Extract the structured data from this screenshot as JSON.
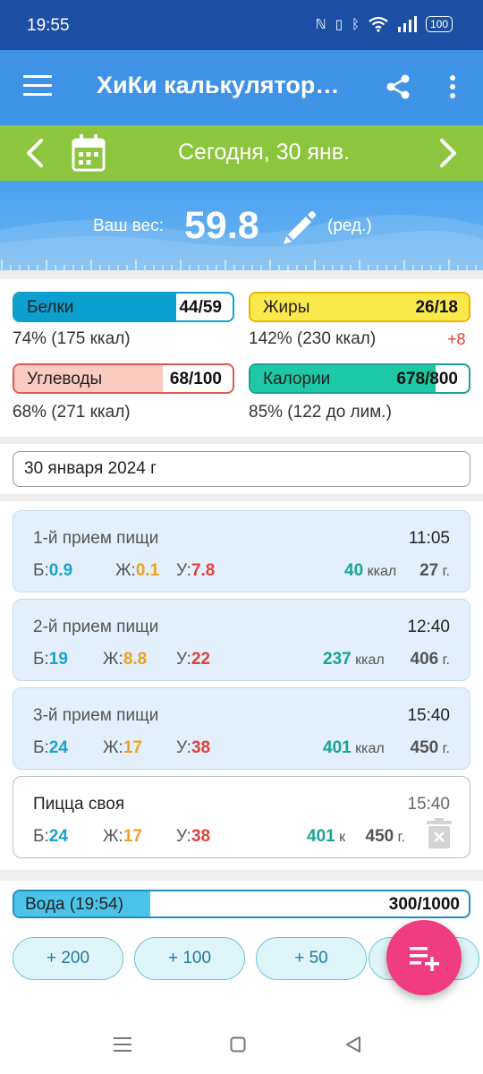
{
  "status": {
    "time": "19:55",
    "battery": "100"
  },
  "app": {
    "title": "ХиКи калькулятор…"
  },
  "date_bar": {
    "text": "Сегодня, 30 янв."
  },
  "weight": {
    "label": "Ваш вес:",
    "value": "59.8",
    "edit": "(ред.)"
  },
  "nutrients": [
    {
      "label": "Белки",
      "value": "44/59",
      "percent_text": "74% (175 ккал)",
      "fill": 0.74,
      "fill_color": "#0c9fcf",
      "border_color": "#0c9fcf",
      "extra": ""
    },
    {
      "label": "Жиры",
      "value": "26/18",
      "percent_text": "142% (230 ккал)",
      "fill": 1.0,
      "fill_color": "#fbe94c",
      "border_color": "#e8b500",
      "extra": "+8"
    },
    {
      "label": "Углеводы",
      "value": "68/100",
      "percent_text": "68% (271 ккал)",
      "fill": 0.68,
      "fill_color": "#fbcac0",
      "border_color": "#e05a54",
      "extra": ""
    },
    {
      "label": "Калории",
      "value": "678/800",
      "percent_text": "85% (122 до лим.)",
      "fill": 0.85,
      "fill_color": "#1cc9a4",
      "border_color": "#18a491",
      "extra": ""
    }
  ],
  "date_field": {
    "value": "30 января 2024 г"
  },
  "macro_labels": {
    "protein": "Б:",
    "fat": "Ж:",
    "carbs": "У:"
  },
  "meals": [
    {
      "name": "1-й прием пищи",
      "time": "11:05",
      "protein": "0.9",
      "fat": "0.1",
      "carbs": "7.8",
      "kcal": "40",
      "kcal_unit": "ккал",
      "grams": "27",
      "grams_unit": "г."
    },
    {
      "name": "2-й прием пищи",
      "time": "12:40",
      "protein": "19",
      "fat": "8.8",
      "carbs": "22",
      "kcal": "237",
      "kcal_unit": "ккал",
      "grams": "406",
      "grams_unit": "г."
    },
    {
      "name": "3-й прием пищи",
      "time": "15:40",
      "protein": "24",
      "fat": "17",
      "carbs": "38",
      "kcal": "401",
      "kcal_unit": "ккал",
      "grams": "450",
      "grams_unit": "г."
    },
    {
      "name": "Пицца своя",
      "time": "15:40",
      "protein": "24",
      "fat": "17",
      "carbs": "38",
      "kcal": "401",
      "kcal_unit": "к",
      "grams": "450",
      "grams_unit": "г."
    }
  ],
  "water": {
    "label": "Вода (19:54)",
    "value": "300/1000",
    "fill": 0.3,
    "buttons": [
      "+ 200",
      "+ 100",
      "+ 50"
    ]
  },
  "icons": {
    "menu": "hamburger-icon",
    "share": "share-icon",
    "more": "more-vert-icon",
    "calendar": "calendar-icon",
    "pencil": "pencil-icon",
    "trash": "trash-icon",
    "fab": "add-list-icon"
  }
}
